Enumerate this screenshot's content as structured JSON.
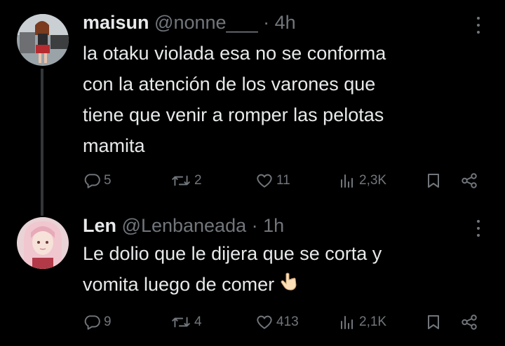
{
  "tweets": [
    {
      "name": "maisun",
      "handle": "@nonne___",
      "separator": "·",
      "time": "4h",
      "lines": [
        "la otaku violada esa no se conforma",
        "con la atención de los varones que",
        "tiene que venir a romper las pelotas",
        "mamita"
      ],
      "stats": {
        "replies": "5",
        "retweets": "2",
        "likes": "11",
        "views": "2,3K"
      }
    },
    {
      "name": "Len",
      "handle": "@Lenbaneada",
      "separator": "·",
      "time": "1h",
      "lines": [
        "Le dolio que le dijera que se corta y",
        "vomita luego de comer"
      ],
      "stats": {
        "replies": "9",
        "retweets": "4",
        "likes": "413",
        "views": "2,1K"
      }
    }
  ],
  "icons": [
    "reply-icon",
    "retweet-icon",
    "like-icon",
    "views-icon",
    "bookmark-icon",
    "share-icon",
    "more-icon",
    "pointing-hand-emoji"
  ],
  "colors": {
    "background": "#000000",
    "text": "#e7e9ea",
    "muted": "#71767b",
    "thread_line": "#333639"
  }
}
